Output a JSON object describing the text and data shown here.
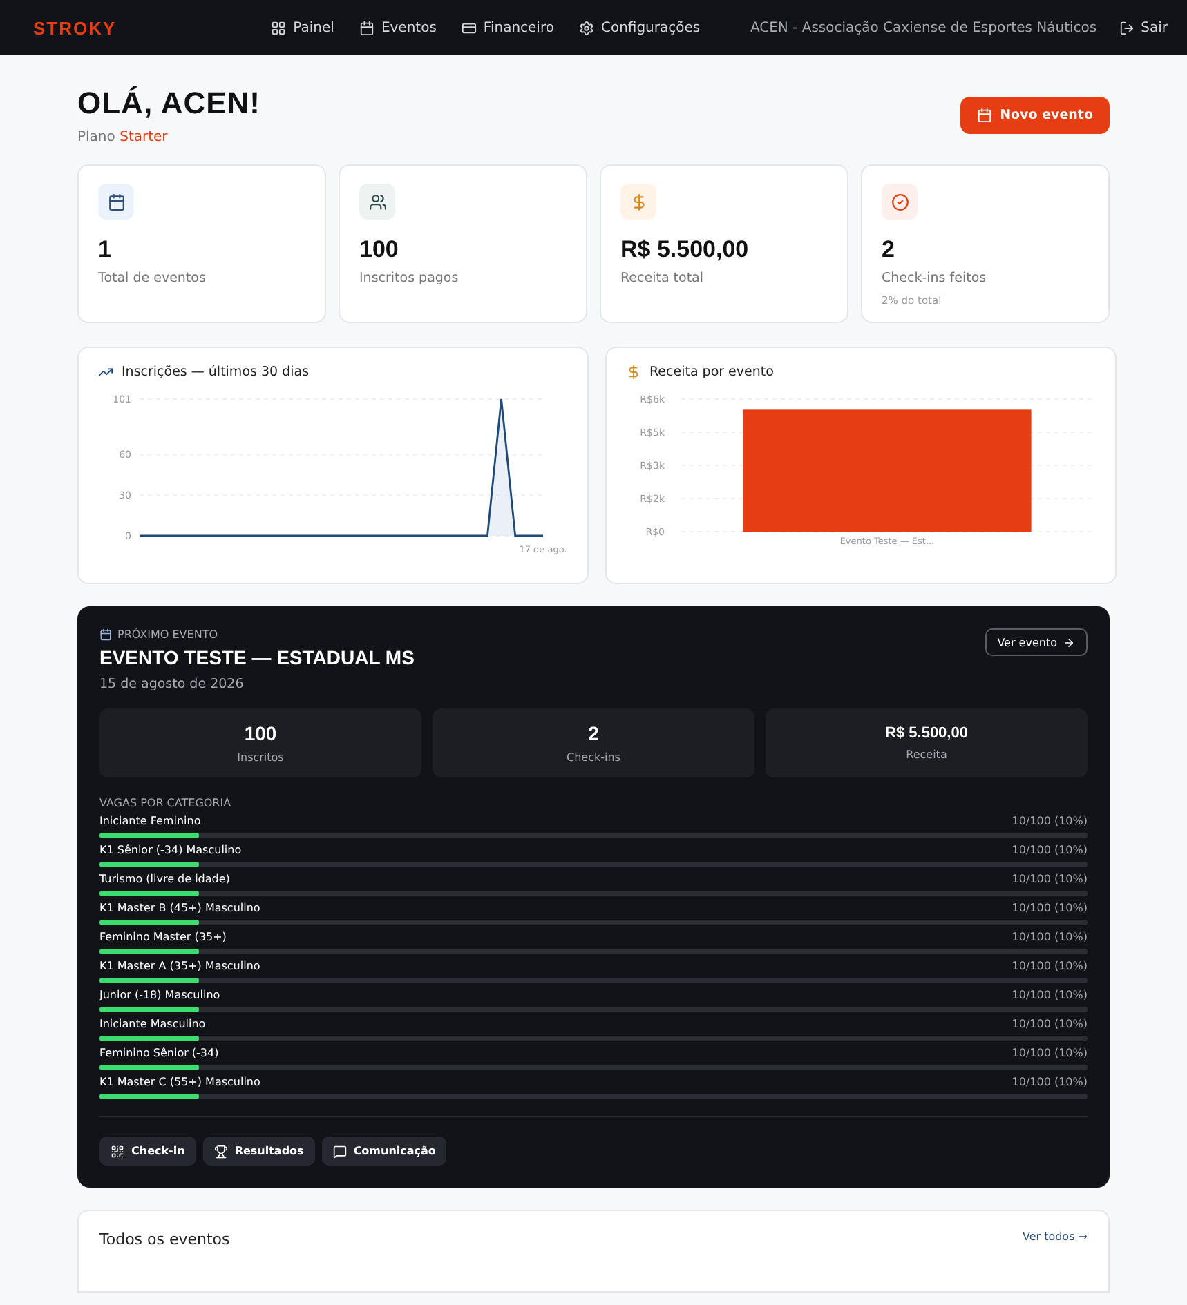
{
  "nav": {
    "logo": "STROKY",
    "links": [
      {
        "label": "Painel"
      },
      {
        "label": "Eventos"
      },
      {
        "label": "Financeiro"
      },
      {
        "label": "Configurações"
      }
    ],
    "org": "ACEN - Associação Caxiense de Esportes Náuticos",
    "logout": "Sair"
  },
  "header": {
    "greeting": "OLÁ, ACEN!",
    "plan_label": "Plano",
    "plan": "Starter",
    "new_button": "Novo evento"
  },
  "stats": [
    {
      "value": "1",
      "label": "Total de eventos"
    },
    {
      "value": "100",
      "label": "Inscritos pagos"
    },
    {
      "value": "R$ 5.500,00",
      "label": "Receita total"
    },
    {
      "value": "2",
      "label": "Check-ins feitos",
      "note": "2% do total"
    }
  ],
  "signups_chart": {
    "title": "Inscrições — últimos 30 dias",
    "chart_data": {
      "type": "area",
      "categories": [
        null,
        null,
        null,
        null,
        null,
        null,
        null,
        null,
        null,
        null,
        null,
        null,
        null,
        null,
        null,
        null,
        null,
        null,
        null,
        null,
        null,
        null,
        null,
        null,
        null,
        null,
        null,
        null,
        null,
        "17 de ago."
      ],
      "values": [
        0,
        0,
        0,
        0,
        0,
        0,
        0,
        0,
        0,
        0,
        0,
        0,
        0,
        0,
        0,
        0,
        0,
        0,
        0,
        0,
        0,
        0,
        0,
        0,
        0,
        0,
        101,
        0,
        0,
        0
      ],
      "ylim": [
        0,
        101
      ],
      "yticks": [
        0,
        30,
        60,
        101
      ]
    }
  },
  "revenue_chart": {
    "title": "Receita por evento",
    "y_axis_labels": [
      "R$6k",
      "R$5k",
      "R$3k",
      "R$2k",
      "R$0"
    ],
    "bar_labels": [
      "Evento Teste — Est..."
    ]
  },
  "next_event": {
    "eyebrow": "PRÓXIMO EVENTO",
    "title": "EVENTO TESTE — ESTADUAL MS",
    "date": "15 de agosto de 2026",
    "view_button": "Ver evento",
    "metrics": [
      {
        "value": "100",
        "label": "Inscritos"
      },
      {
        "value": "2",
        "label": "Check-ins"
      },
      {
        "value": "R$ 5.500,00",
        "label": "Receita"
      }
    ],
    "categories_title": "VAGAS POR CATEGORIA",
    "categories": [
      {
        "name": "Iniciante Feminino",
        "count": "10/100 (10%)",
        "level": 0.1
      },
      {
        "name": "K1 Sênior (-34) Masculino",
        "count": "10/100 (10%)",
        "level": 0.1
      },
      {
        "name": "Turismo (livre de idade)",
        "count": "10/100 (10%)",
        "level": 0.1
      },
      {
        "name": "K1 Master B (45+) Masculino",
        "count": "10/100 (10%)",
        "level": 0.1
      },
      {
        "name": "Feminino Master (35+)",
        "count": "10/100 (10%)",
        "level": 0.1
      },
      {
        "name": "K1 Master A (35+) Masculino",
        "count": "10/100 (10%)",
        "level": 0.1
      },
      {
        "name": "Junior (-18) Masculino",
        "count": "10/100 (10%)",
        "level": 0.1
      },
      {
        "name": "Iniciante Masculino",
        "count": "10/100 (10%)",
        "level": 0.1
      },
      {
        "name": "Feminino Sênior (-34)",
        "count": "10/100 (10%)",
        "level": 0.1
      },
      {
        "name": "K1 Master C (55+) Masculino",
        "count": "10/100 (10%)",
        "level": 0.1
      }
    ],
    "actions": [
      {
        "label": "Check-in"
      },
      {
        "label": "Resultados"
      },
      {
        "label": "Comunicação"
      }
    ]
  },
  "all_events": {
    "title": "Todos os eventos",
    "link": "Ver todos →"
  }
}
